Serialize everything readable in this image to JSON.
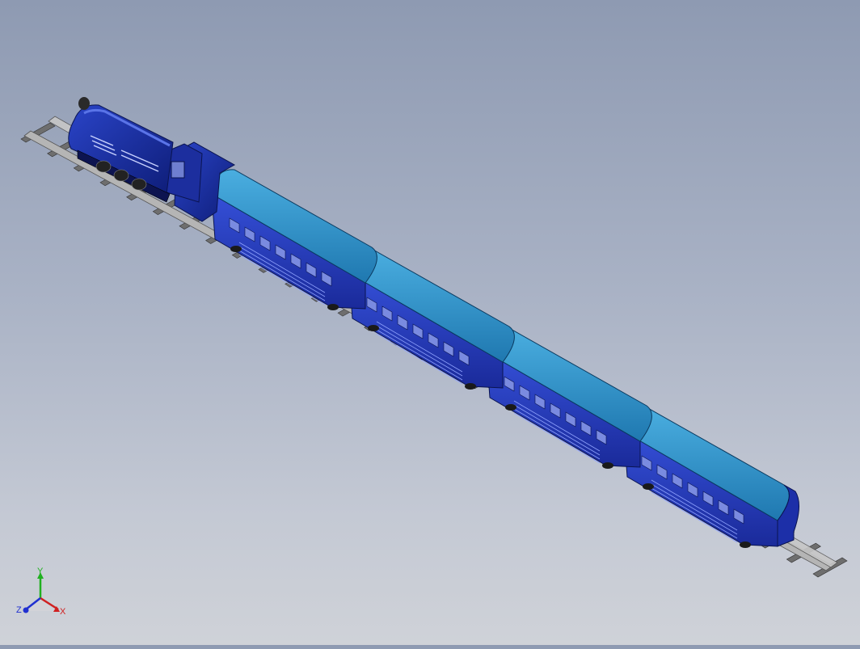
{
  "scene": {
    "model": "steam-locomotive-with-four-passenger-coaches",
    "view": "isometric",
    "colors": {
      "background_top": "#8e9ab2",
      "background_bottom": "#cfd2d8",
      "locomotive": "#1a2f9e",
      "coach_roof": "#2e8fc4",
      "coach_body": "#2a3fc0",
      "rail": "#b8b8b8",
      "sleeper": "#6e6e6e"
    },
    "coach_count": 4
  },
  "triad": {
    "y_label": "Y",
    "z_label": "Z",
    "x_label": "X",
    "colors": {
      "x": "#d02020",
      "y": "#20b020",
      "z": "#2030d0"
    }
  }
}
